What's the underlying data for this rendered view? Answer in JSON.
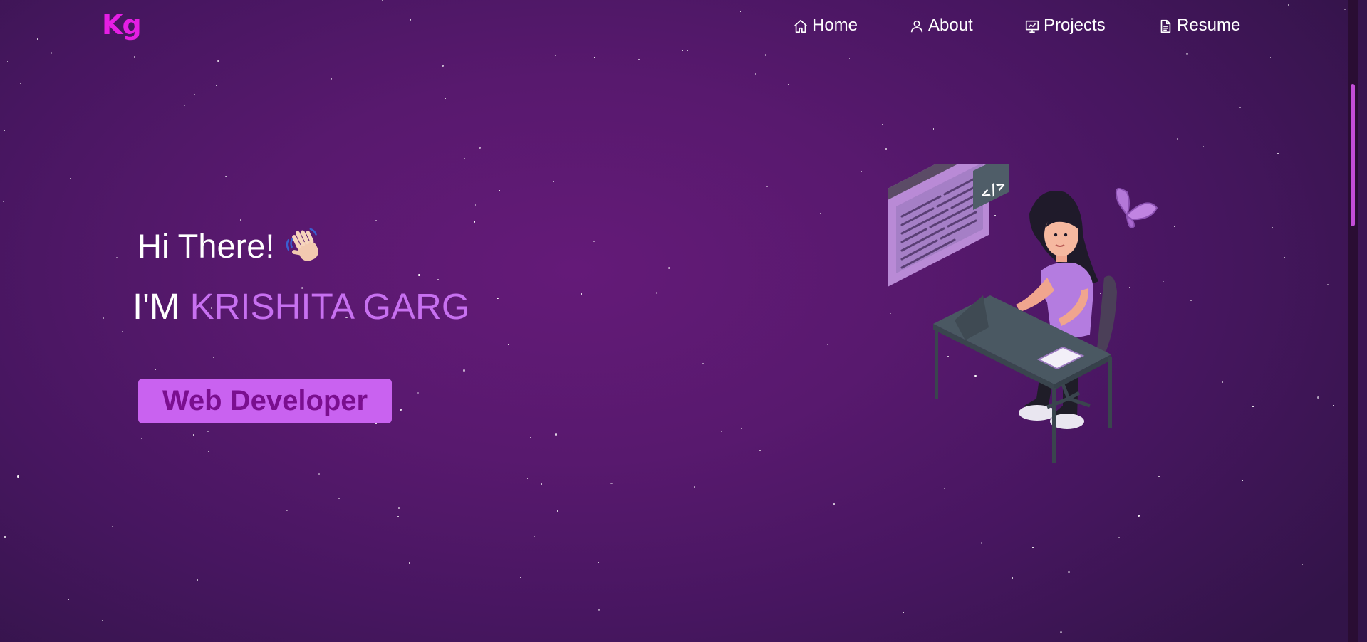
{
  "navbar": {
    "logo": "Kg",
    "links": [
      {
        "label": "Home",
        "icon": "home-icon"
      },
      {
        "label": "About",
        "icon": "user-icon"
      },
      {
        "label": "Projects",
        "icon": "presentation-icon"
      },
      {
        "label": "Resume",
        "icon": "document-icon"
      }
    ]
  },
  "hero": {
    "greeting": "Hi There!",
    "name_prefix": "I'M",
    "name": "KRISHITA GARG",
    "role": "Web Developer",
    "illustration_code_label": "</>"
  },
  "colors": {
    "logo": "#e51ee4",
    "accent": "#c770f0",
    "role_box": "#c962f0",
    "role_text": "#7a0f8f",
    "background_center": "#641a78",
    "background_edge": "#321448"
  }
}
